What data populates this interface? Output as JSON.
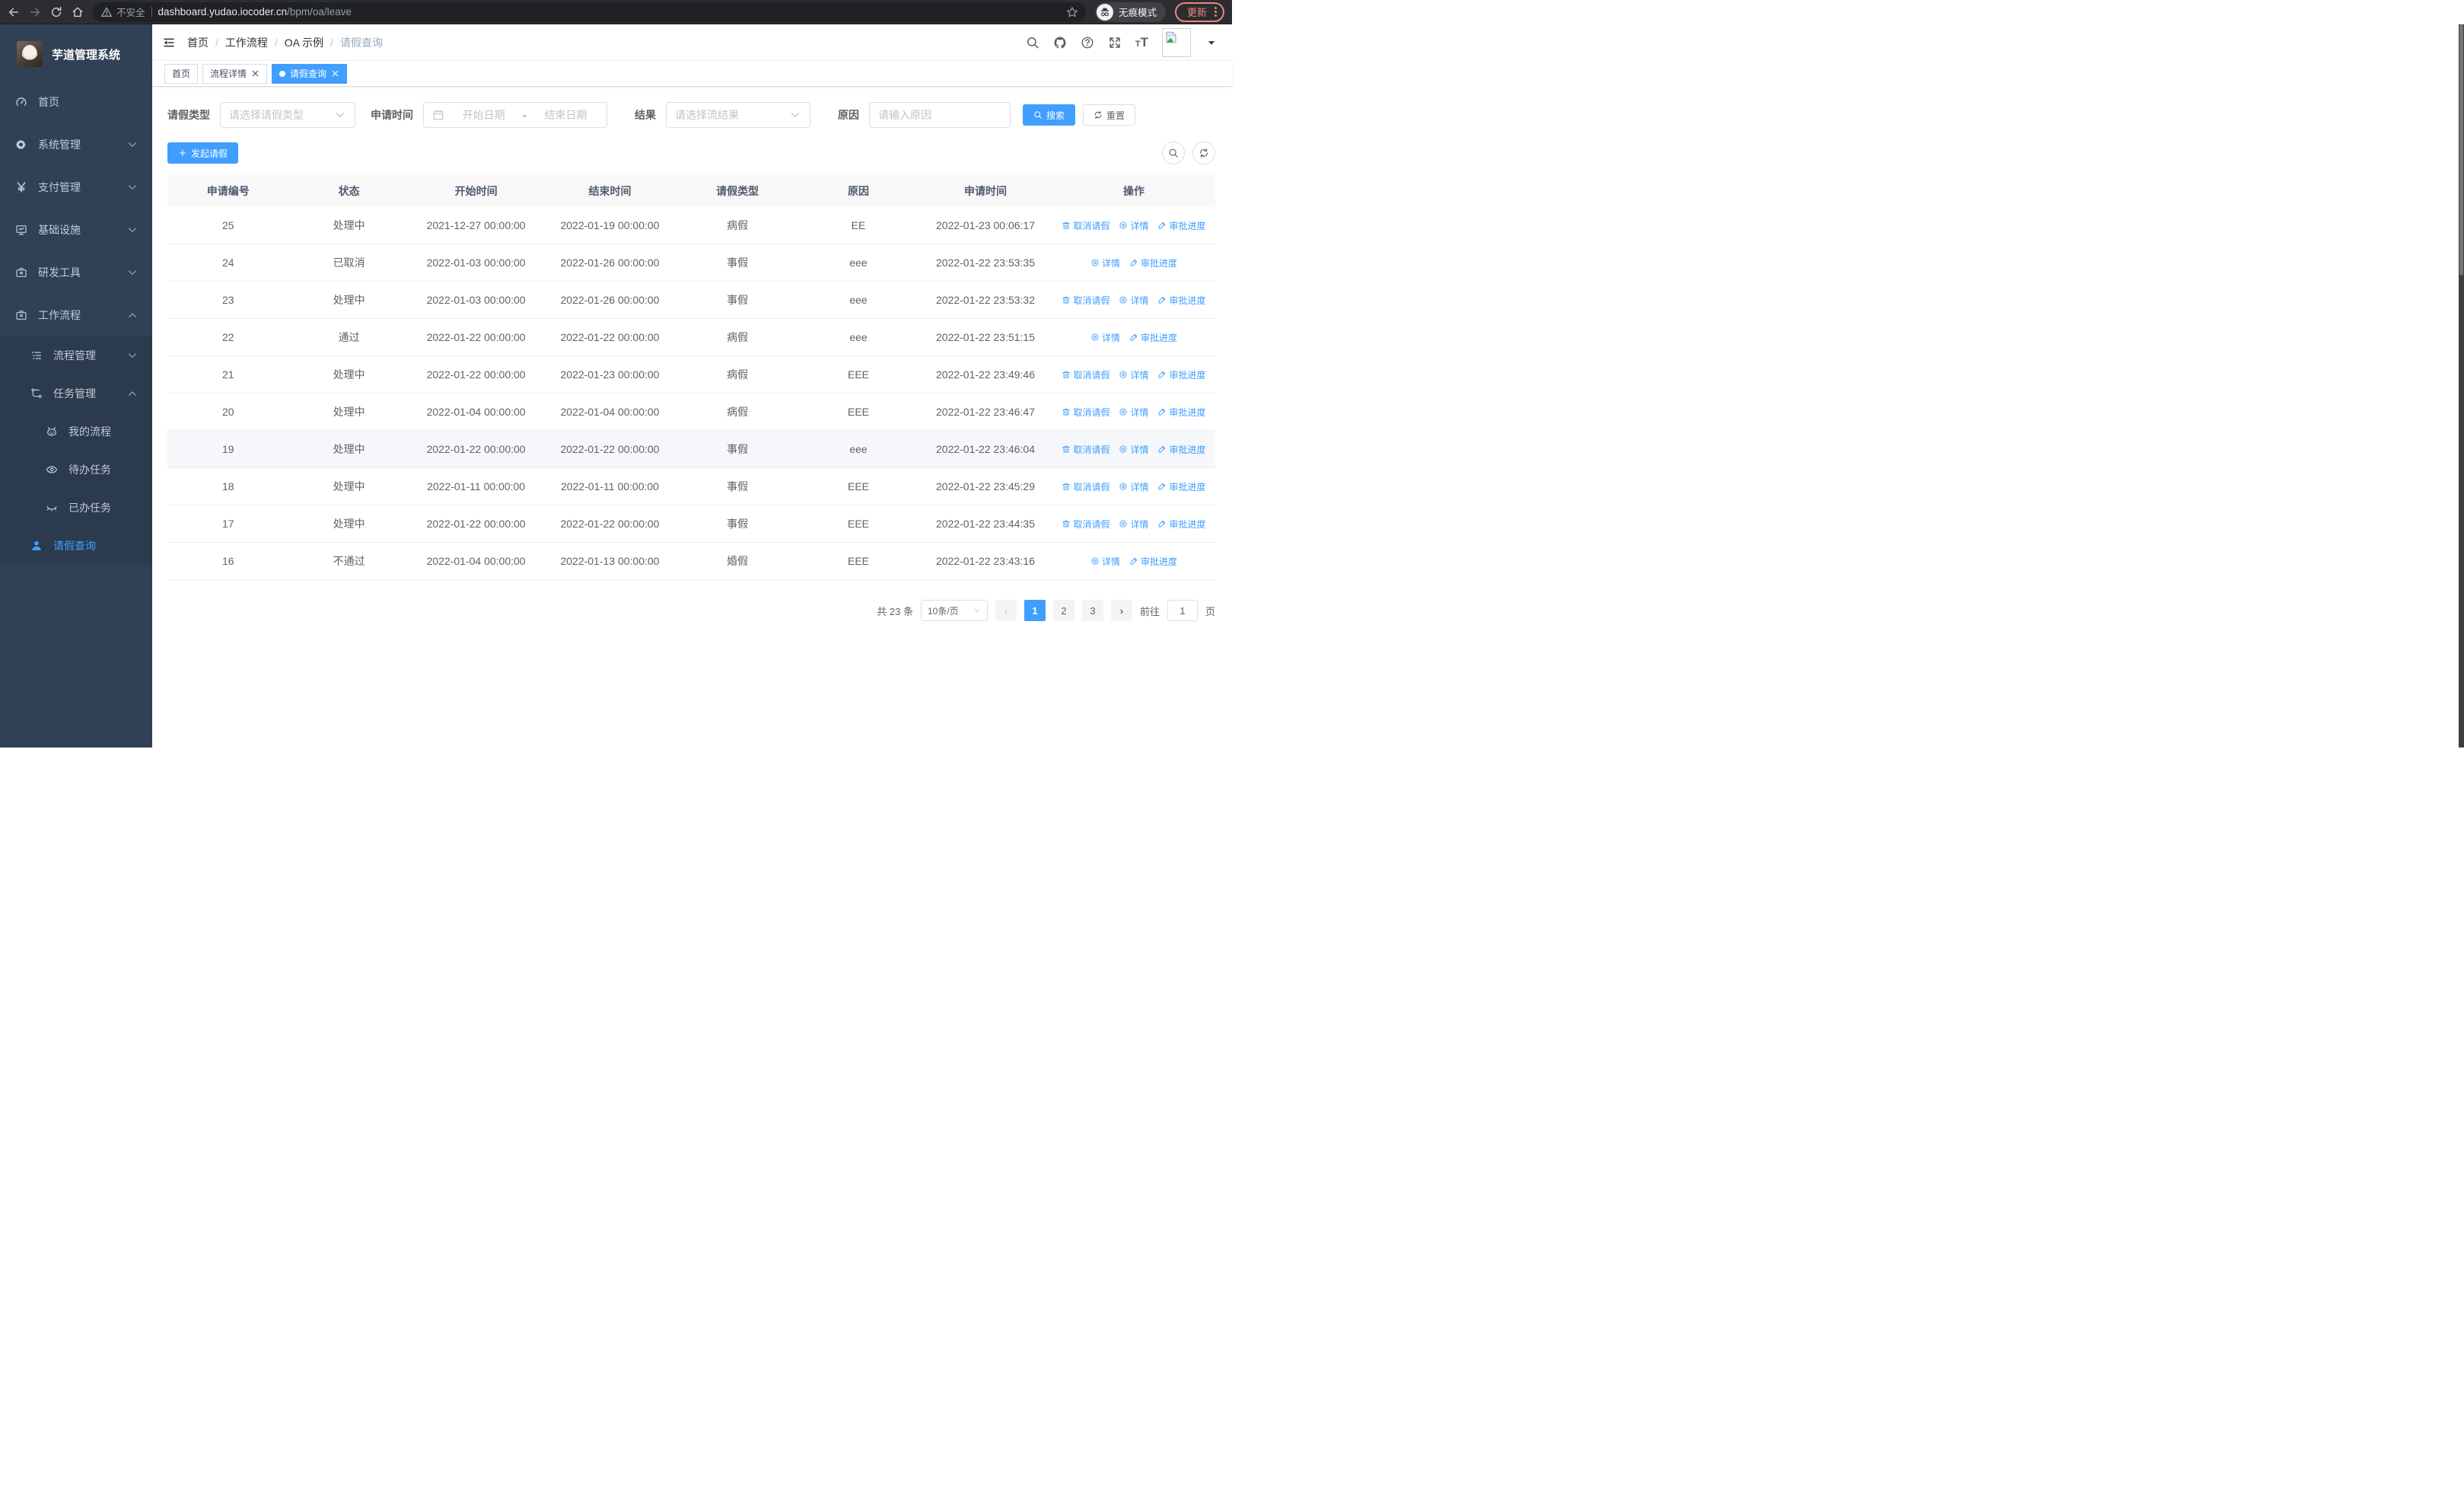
{
  "browser": {
    "insecure": "不安全",
    "url_host": "dashboard.yudao.iocoder.cn",
    "url_path": "/bpm/oa/leave",
    "incognito": "无痕模式",
    "update": "更新"
  },
  "colors": {
    "primary": "#409eff",
    "sidebar_bg": "#304156",
    "submenu_bg": "#2b3a4c",
    "sidebar_text": "#bfcbd9",
    "link_blue": "#409eff",
    "update_accent": "#e9887a",
    "table_header_bg": "#f8f8f9",
    "row_highlight": "#f5f7fa"
  },
  "sidebar": {
    "title": "芋道管理系统",
    "items": [
      {
        "label": "首页",
        "icon": "dashboard-icon"
      },
      {
        "label": "系统管理",
        "icon": "gear-icon"
      },
      {
        "label": "支付管理",
        "icon": "yen-icon"
      },
      {
        "label": "基础设施",
        "icon": "monitor-icon"
      },
      {
        "label": "研发工具",
        "icon": "toolbox-icon"
      },
      {
        "label": "工作流程",
        "icon": "toolbox-icon"
      }
    ],
    "submenu": [
      {
        "label": "流程管理",
        "icon": "tree-list-icon"
      },
      {
        "label": "任务管理",
        "icon": "flow-icon"
      },
      {
        "label": "我的流程",
        "icon": "robot-icon"
      },
      {
        "label": "待办任务",
        "icon": "eye-open-icon"
      },
      {
        "label": "已办任务",
        "icon": "eye-closed-icon"
      },
      {
        "label": "请假查询",
        "icon": "person-icon"
      }
    ]
  },
  "header": {
    "breadcrumb": [
      "首页",
      "工作流程",
      "OA 示例",
      "请假查询"
    ]
  },
  "tabs": [
    {
      "label": "首页",
      "closable": false,
      "active": false
    },
    {
      "label": "流程详情",
      "closable": true,
      "active": false
    },
    {
      "label": "请假查询",
      "closable": true,
      "active": true
    }
  ],
  "filters": {
    "leave_type_label": "请假类型",
    "leave_type_placeholder": "请选择请假类型",
    "apply_time_label": "申请时间",
    "date_start_placeholder": "开始日期",
    "date_separator": "-",
    "date_end_placeholder": "结束日期",
    "result_label": "结果",
    "result_placeholder": "请选择流结果",
    "reason_label": "原因",
    "reason_placeholder": "请输入原因",
    "search_label": "搜索",
    "reset_label": "重置"
  },
  "toolbar": {
    "create_label": "发起请假"
  },
  "table": {
    "headers": [
      "申请编号",
      "状态",
      "开始时间",
      "结束时间",
      "请假类型",
      "原因",
      "申请时间",
      "操作"
    ],
    "actions": {
      "cancel": "取消请假",
      "detail": "详情",
      "progress": "审批进度"
    },
    "rows": [
      {
        "id": "25",
        "status": "处理中",
        "start": "2021-12-27 00:00:00",
        "end": "2022-01-19 00:00:00",
        "type": "病假",
        "reason": "EE",
        "apply_time": "2022-01-23 00:06:17",
        "can_cancel": true,
        "highlighted": false
      },
      {
        "id": "24",
        "status": "已取消",
        "start": "2022-01-03 00:00:00",
        "end": "2022-01-26 00:00:00",
        "type": "事假",
        "reason": "eee",
        "apply_time": "2022-01-22 23:53:35",
        "can_cancel": false,
        "highlighted": false
      },
      {
        "id": "23",
        "status": "处理中",
        "start": "2022-01-03 00:00:00",
        "end": "2022-01-26 00:00:00",
        "type": "事假",
        "reason": "eee",
        "apply_time": "2022-01-22 23:53:32",
        "can_cancel": true,
        "highlighted": false
      },
      {
        "id": "22",
        "status": "通过",
        "start": "2022-01-22 00:00:00",
        "end": "2022-01-22 00:00:00",
        "type": "病假",
        "reason": "eee",
        "apply_time": "2022-01-22 23:51:15",
        "can_cancel": false,
        "highlighted": false
      },
      {
        "id": "21",
        "status": "处理中",
        "start": "2022-01-22 00:00:00",
        "end": "2022-01-23 00:00:00",
        "type": "病假",
        "reason": "EEE",
        "apply_time": "2022-01-22 23:49:46",
        "can_cancel": true,
        "highlighted": false
      },
      {
        "id": "20",
        "status": "处理中",
        "start": "2022-01-04 00:00:00",
        "end": "2022-01-04 00:00:00",
        "type": "病假",
        "reason": "EEE",
        "apply_time": "2022-01-22 23:46:47",
        "can_cancel": true,
        "highlighted": false
      },
      {
        "id": "19",
        "status": "处理中",
        "start": "2022-01-22 00:00:00",
        "end": "2022-01-22 00:00:00",
        "type": "事假",
        "reason": "eee",
        "apply_time": "2022-01-22 23:46:04",
        "can_cancel": true,
        "highlighted": true
      },
      {
        "id": "18",
        "status": "处理中",
        "start": "2022-01-11 00:00:00",
        "end": "2022-01-11 00:00:00",
        "type": "事假",
        "reason": "EEE",
        "apply_time": "2022-01-22 23:45:29",
        "can_cancel": true,
        "highlighted": false
      },
      {
        "id": "17",
        "status": "处理中",
        "start": "2022-01-22 00:00:00",
        "end": "2022-01-22 00:00:00",
        "type": "事假",
        "reason": "EEE",
        "apply_time": "2022-01-22 23:44:35",
        "can_cancel": true,
        "highlighted": false
      },
      {
        "id": "16",
        "status": "不通过",
        "start": "2022-01-04 00:00:00",
        "end": "2022-01-13 00:00:00",
        "type": "婚假",
        "reason": "EEE",
        "apply_time": "2022-01-22 23:43:16",
        "can_cancel": false,
        "highlighted": false
      }
    ]
  },
  "pagination": {
    "total": "共 23 条",
    "page_size": "10条/页",
    "pages": [
      "1",
      "2",
      "3"
    ],
    "goto_label": "前往",
    "goto_value": "1",
    "unit": "页"
  }
}
